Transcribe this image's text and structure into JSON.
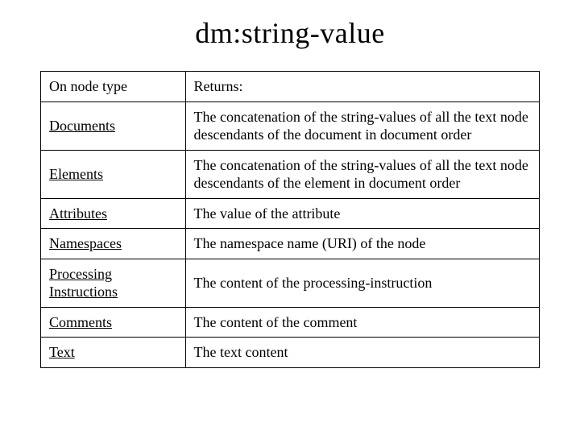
{
  "title": "dm:string-value",
  "header": {
    "left": "On node type",
    "right": "Returns:"
  },
  "rows": [
    {
      "type": "Documents",
      "returns": "The concatenation of the string-values of all the text node descendants of the document in document order"
    },
    {
      "type": "Elements",
      "returns": "The concatenation of the string-values of all the text node descendants of the element in document order"
    },
    {
      "type": "Attributes",
      "returns": "The value of the attribute"
    },
    {
      "type": "Namespaces",
      "returns": "The namespace name (URI) of the node"
    },
    {
      "type": "Processing Instructions",
      "returns": "The content of the processing-instruction"
    },
    {
      "type": "Comments",
      "returns": "The content of the comment"
    },
    {
      "type": "Text",
      "returns": "The text content"
    }
  ]
}
